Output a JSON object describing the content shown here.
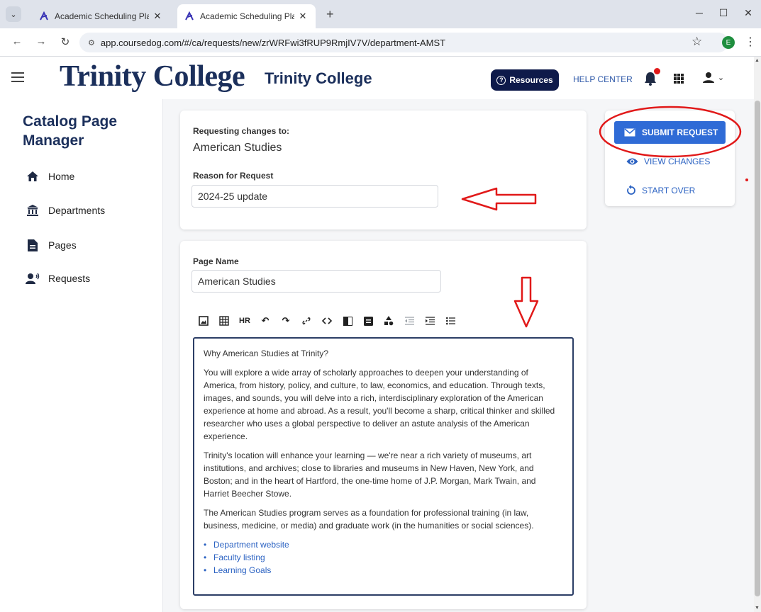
{
  "browser": {
    "tabs": [
      {
        "title": "Academic Scheduling Platform",
        "active": false
      },
      {
        "title": "Academic Scheduling Platform",
        "active": true
      }
    ],
    "new_tab": "+",
    "url": "app.coursedog.com/#/ca/requests/new/zrWRFwi3fRUP9RmjIV7V/department-AMST",
    "profile_initial": "E"
  },
  "header": {
    "logo_text": "Trinity College",
    "institution_name": "Trinity College",
    "resources_label": "Resources",
    "help_center_label": "HELP CENTER"
  },
  "sidebar": {
    "title": "Catalog Page Manager",
    "items": [
      {
        "label": "Home",
        "icon": "home-icon"
      },
      {
        "label": "Departments",
        "icon": "building-icon"
      },
      {
        "label": "Pages",
        "icon": "file-icon"
      },
      {
        "label": "Requests",
        "icon": "person-voice-icon"
      }
    ]
  },
  "request_card": {
    "requesting_label": "Requesting changes to:",
    "requesting_value": "American Studies",
    "reason_label": "Reason for Request",
    "reason_value": "2024-25 update"
  },
  "page_card": {
    "page_name_label": "Page Name",
    "page_name_value": "American Studies",
    "toolbar": [
      "image-icon",
      "table-icon",
      "HR",
      "undo-icon",
      "redo-icon",
      "link-icon",
      "code-icon",
      "block-icon",
      "card-icon",
      "shapes-icon",
      "outdent-icon",
      "indent-icon",
      "bulleted-list-icon"
    ],
    "hr_label": "HR",
    "editor": {
      "heading": "Why American Studies at Trinity?",
      "para1": "You will explore a wide array of scholarly approaches to deepen your understanding of America, from history, policy, and culture, to law, economics, and education. Through texts, images, and sounds, you will delve into a rich, interdisciplinary exploration of the American experience at home and abroad. As a result, you'll become a sharp, critical thinker and skilled researcher who uses a global perspective to deliver an astute analysis of the American experience.",
      "para2": "Trinity's location will enhance your learning — we're near a rich variety of museums, art institutions, and archives; close to libraries and museums in New Haven, New York, and Boston; and in the heart of Hartford, the one-time home of J.P. Morgan, Mark Twain, and Harriet Beecher Stowe.",
      "para3": "The American Studies program serves as a foundation for professional training (in law, business, medicine, or media) and graduate work (in the humanities or social sciences).",
      "links": [
        "Department website",
        "Faculty listing",
        "Learning Goals"
      ]
    }
  },
  "actions": {
    "submit_label": "SUBMIT REQUEST",
    "view_changes_label": "VIEW CHANGES",
    "start_over_label": "START OVER"
  },
  "colors": {
    "brand_navy": "#1b2f5b",
    "primary_blue": "#2f6bd6",
    "link_blue": "#2b62c2",
    "annotation_red": "#e11919"
  }
}
